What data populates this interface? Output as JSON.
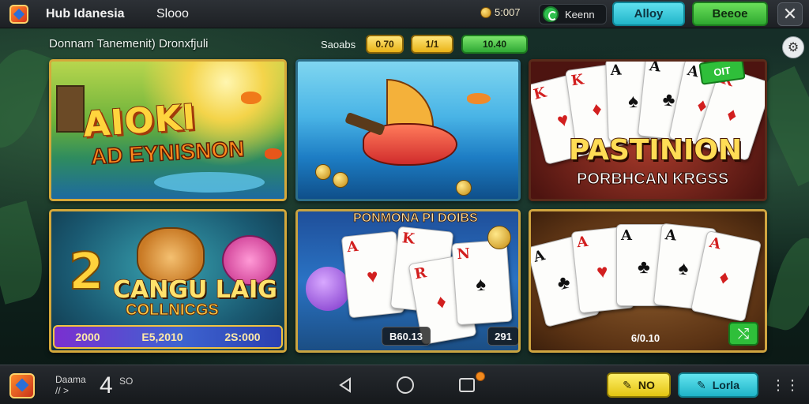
{
  "header": {
    "app_title": "Hub Idanesia",
    "top_link": "Slooo",
    "coin_value": "5:007",
    "gem_label": "Keenn",
    "btn_allow": "Alloy",
    "btn_green": "Beeoe",
    "close_glyph": "✕"
  },
  "subheader": {
    "section_title": "Donnam Tanemenit) Dronxfjuli",
    "filter_label": "Saoabs",
    "chips": [
      "0.70",
      "1/1",
      "10.40"
    ],
    "settings_glyph": "⚙"
  },
  "tiles": [
    {
      "title": "AIOKI",
      "subtitle": "AD EYNISNON"
    },
    {
      "title": ""
    },
    {
      "title": "PASTINION",
      "subtitle": "PORBHCAN KRGSS",
      "badge": "OIT"
    },
    {
      "number": "2",
      "title": "CANGU LAIG",
      "subtitle": "COLLNICGS",
      "jackpot": [
        "2000",
        "E5,2010",
        "2S:000"
      ]
    },
    {
      "label": "PONMONA PI DOIBS",
      "amounts": [
        "B60.13",
        "291"
      ]
    },
    {
      "amount": "6/0.10",
      "action_glyph": "⤭"
    }
  ],
  "bottombar": {
    "label_line1": "Daama",
    "label_line2": "// >",
    "level": "4",
    "level_sub": "SO",
    "btn_yellow": "NO",
    "btn_cyan": "Lorla",
    "menu_glyph": "⋮⋮"
  },
  "colors": {
    "accent_cyan": "#21b5c9",
    "accent_green": "#2fa830",
    "accent_gold": "#e9b317",
    "tile_border": "#d5a83a"
  },
  "icons": [
    "app-logo-icon",
    "coin-icon",
    "gem-icon",
    "close-icon",
    "settings-icon",
    "back-icon",
    "home-icon",
    "recent-apps-icon",
    "shuffle-icon",
    "menu-icon"
  ]
}
